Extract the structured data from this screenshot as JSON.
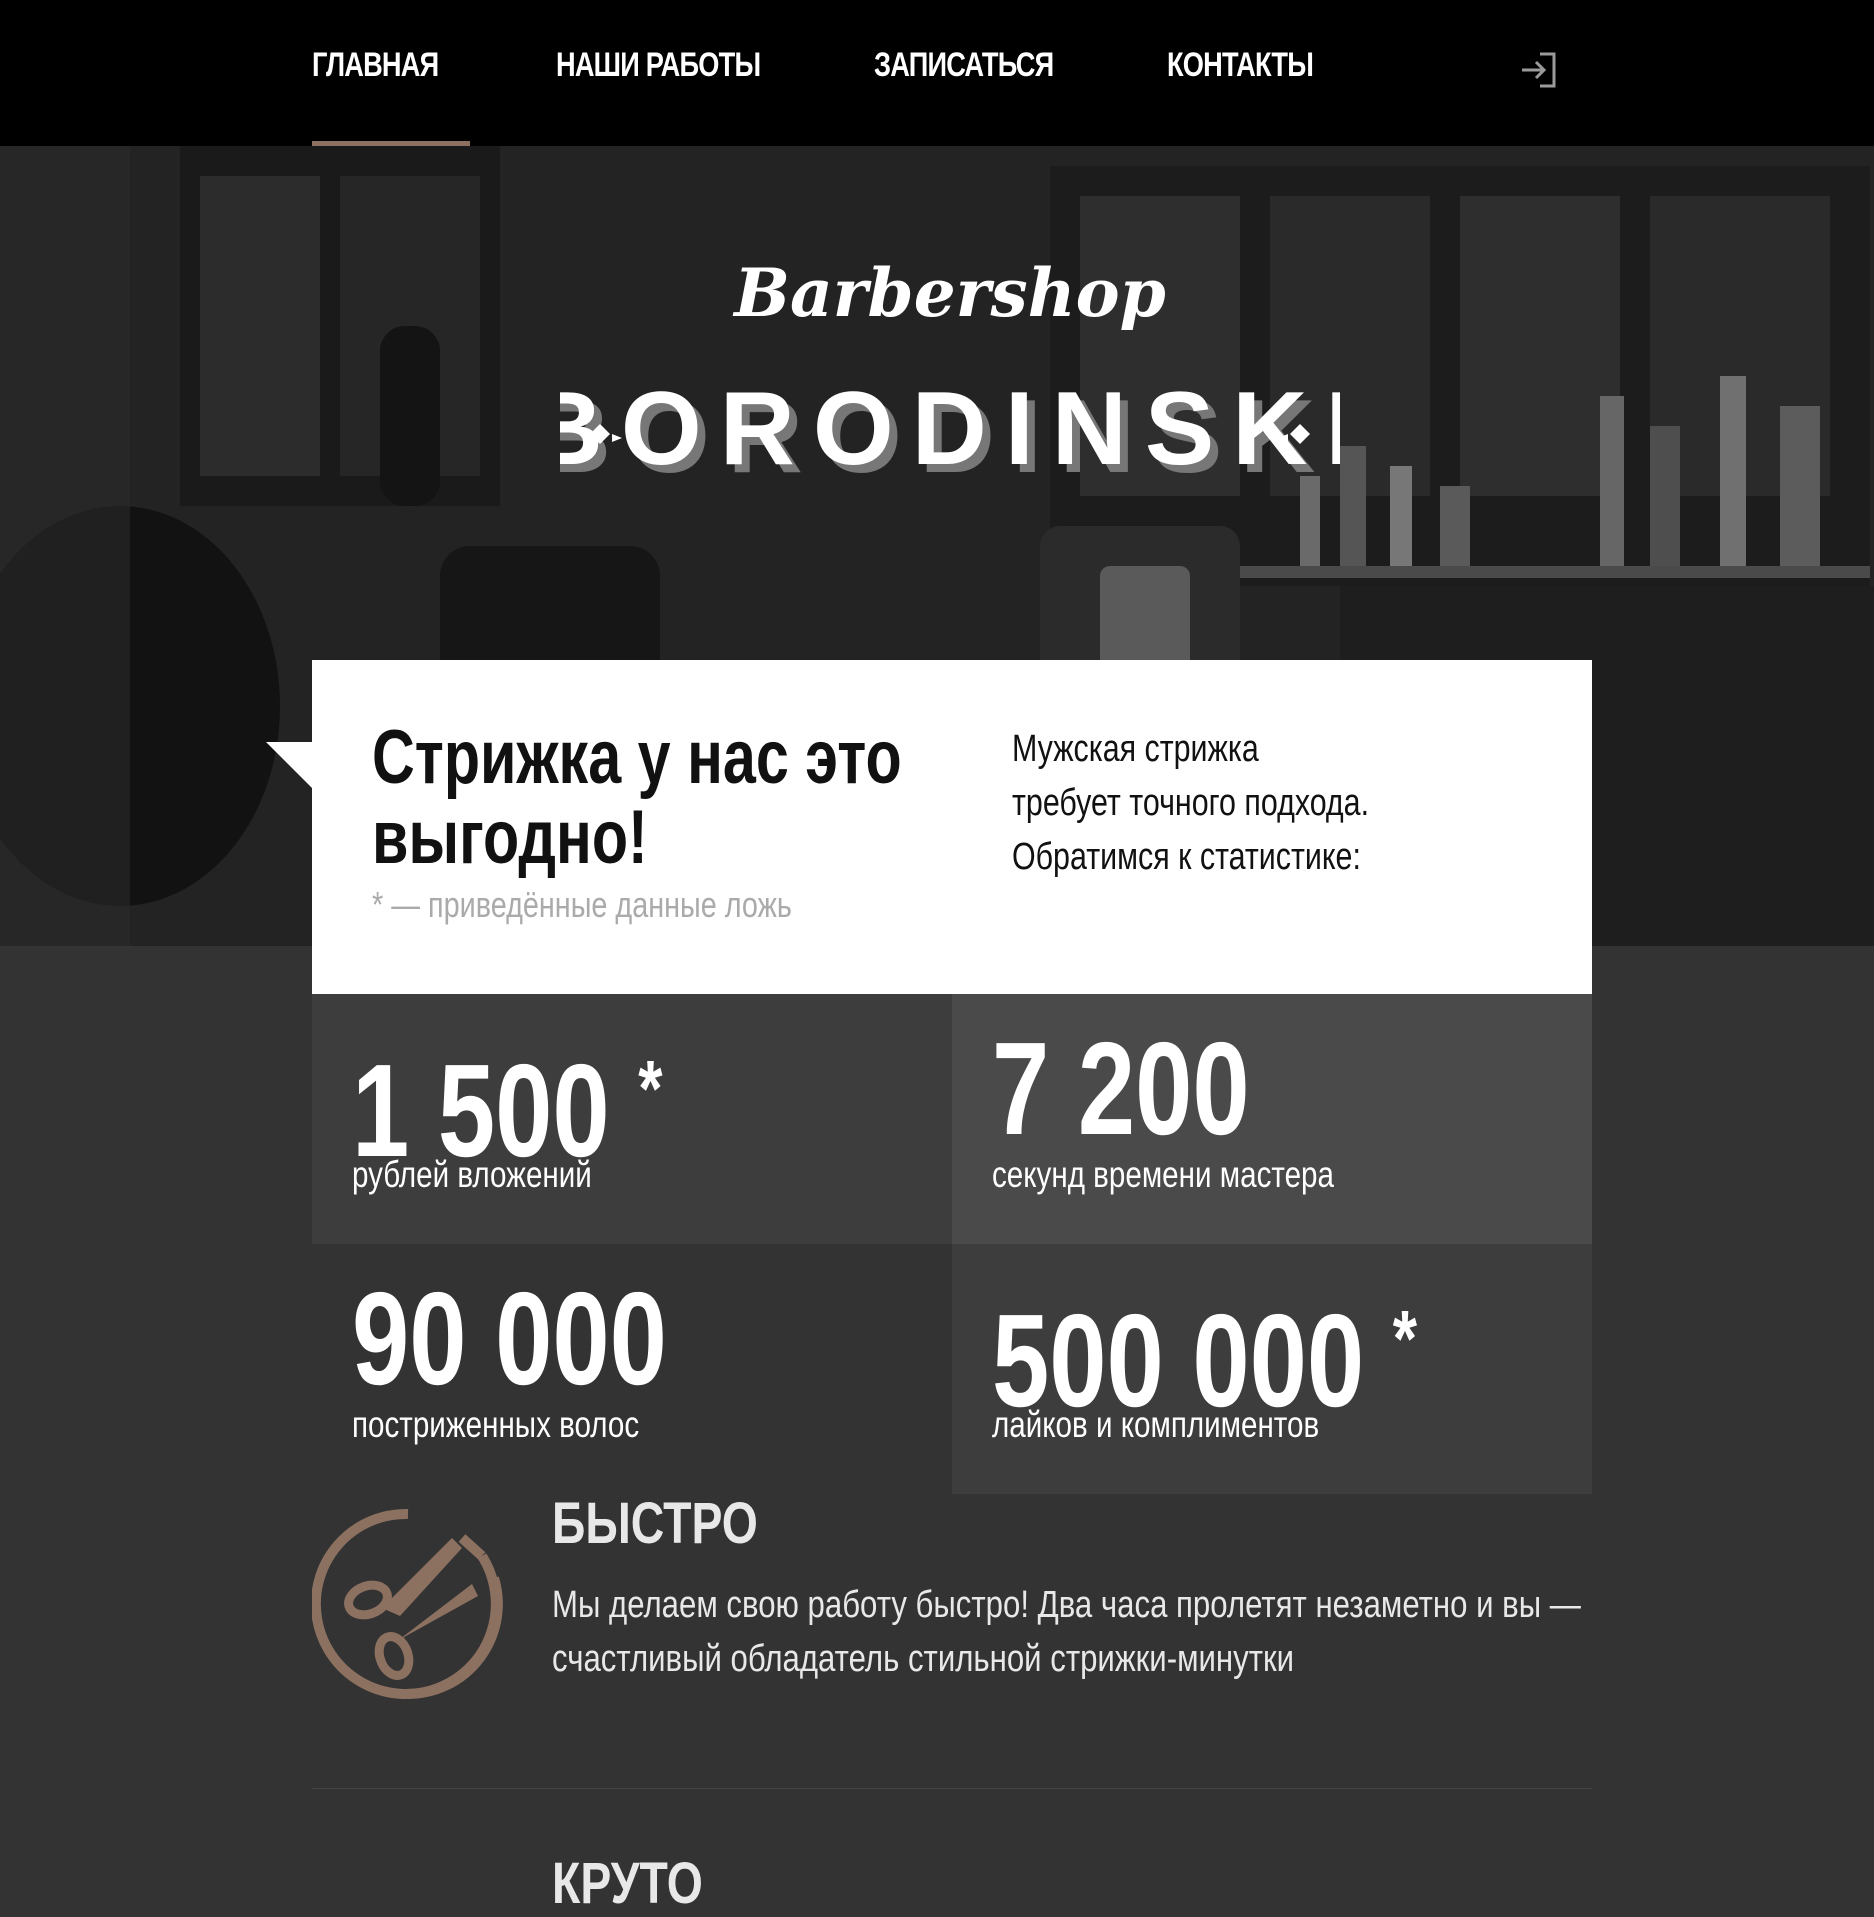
{
  "nav": {
    "items": [
      {
        "label": "ГЛАВНАЯ",
        "active": true
      },
      {
        "label": "НАШИ РАБОТЫ",
        "active": false
      },
      {
        "label": "ЗАПИСАТЬСЯ",
        "active": false
      },
      {
        "label": "КОНТАКТЫ",
        "active": false
      }
    ],
    "login_icon": "login-icon"
  },
  "hero": {
    "logo_script": "Barbershop",
    "logo_main": "BORODINSKI"
  },
  "card": {
    "title": "Стрижка у нас это выгодно!",
    "note": "* — приведённые данные ложь",
    "text_lines": [
      "Мужская стрижка",
      "требует точного подхода.",
      "Обратимся к статистике:"
    ]
  },
  "stats": [
    {
      "value": "1 500",
      "asterisk": "*",
      "label": "рублей вложений"
    },
    {
      "value": "7 200",
      "asterisk": "",
      "label": "секунд времени мастера"
    },
    {
      "value": "90 000",
      "asterisk": "",
      "label": "постриженных волос"
    },
    {
      "value": "500 000",
      "asterisk": "*",
      "label": "лайков и комплиментов"
    }
  ],
  "features": [
    {
      "icon": "scissors-icon",
      "title": "БЫСТРО",
      "text_lines": [
        "Мы делаем свою работу быстро! Два часа пролетят незаметно и вы —",
        "счастливый обладатель стильной стрижки-минутки"
      ]
    },
    {
      "title": "КРУТО"
    }
  ],
  "colors": {
    "accent": "#8c7161",
    "nav_bg": "#000000",
    "page_bg": "#333333",
    "stat_light": "#3d3d3d",
    "stat_dark": "#333333"
  }
}
